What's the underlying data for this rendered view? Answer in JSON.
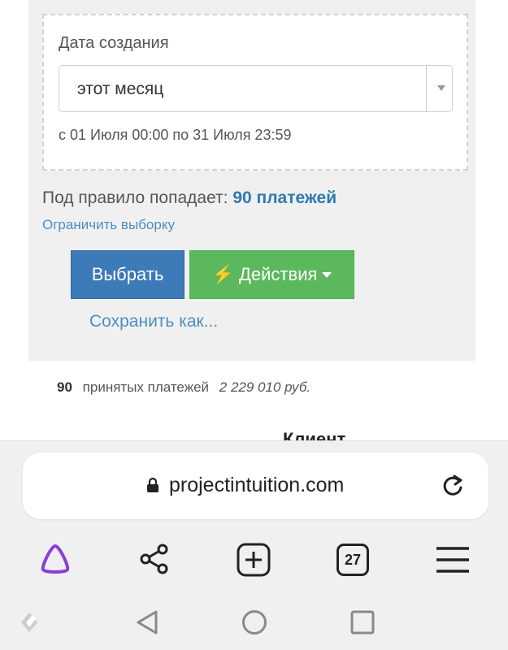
{
  "filter": {
    "label": "Дата создания",
    "select_value": "этот месяц",
    "range_text": "с 01 Июля 00:00 по 31 Июля 23:59"
  },
  "rule": {
    "prefix": "Под правило попадает:",
    "count": "90 платежей",
    "limit_link": "Ограничить выборку"
  },
  "buttons": {
    "select_label": "Выбрать",
    "actions_label": "Действия",
    "save_link": "Сохранить как..."
  },
  "summary": {
    "count": "90",
    "text": "принятых платежей",
    "amount": "2 229 010 руб."
  },
  "table": {
    "client_heading": "Клиент"
  },
  "browser": {
    "url": "projectintuition.com",
    "tab_count": "27",
    "icons": [
      "alice-assistant-icon",
      "share-icon",
      "new-tab-icon",
      "tabs-icon",
      "menu-icon"
    ],
    "accent": "#8b3fd9"
  },
  "system_nav": {
    "icons": [
      "back-icon",
      "home-icon",
      "recents-icon"
    ]
  },
  "colors": {
    "primary_button": "#3c7ab8",
    "actions_button": "#5cb85c",
    "link": "#4b8fc4",
    "count_highlight": "#2f7bb0"
  }
}
